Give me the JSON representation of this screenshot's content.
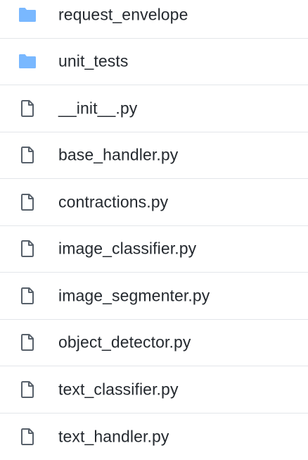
{
  "colors": {
    "folder": "#79b8ff",
    "file_icon": "#57606a",
    "text": "#24292f",
    "divider": "#e3e6ea"
  },
  "files": [
    {
      "name": "request_envelope",
      "type": "folder",
      "icon": "folder-icon"
    },
    {
      "name": "unit_tests",
      "type": "folder",
      "icon": "folder-icon"
    },
    {
      "name": "__init__.py",
      "type": "file",
      "icon": "file-icon"
    },
    {
      "name": "base_handler.py",
      "type": "file",
      "icon": "file-icon"
    },
    {
      "name": "contractions.py",
      "type": "file",
      "icon": "file-icon"
    },
    {
      "name": "image_classifier.py",
      "type": "file",
      "icon": "file-icon"
    },
    {
      "name": "image_segmenter.py",
      "type": "file",
      "icon": "file-icon"
    },
    {
      "name": "object_detector.py",
      "type": "file",
      "icon": "file-icon"
    },
    {
      "name": "text_classifier.py",
      "type": "file",
      "icon": "file-icon"
    },
    {
      "name": "text_handler.py",
      "type": "file",
      "icon": "file-icon"
    }
  ]
}
